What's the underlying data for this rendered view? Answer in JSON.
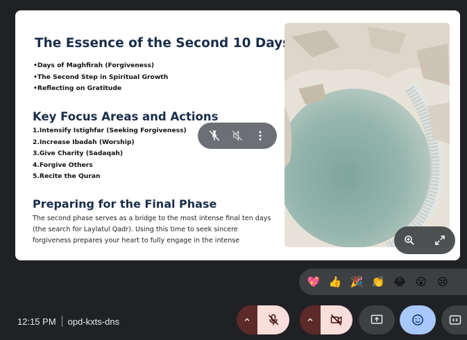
{
  "slide": {
    "heading_essence": "The Essence of the Second 10 Days",
    "bullets": [
      "•Days of Maghfirah (Forgiveness)",
      "•The Second Step in Spiritual Growth",
      "•Reflecting on Gratitude"
    ],
    "heading_key": "Key Focus Areas and Actions",
    "actions": [
      "1.Intensify Istighfar (Seeking Forgiveness)",
      "2.Increase Ibadah (Worship)",
      "3.Give Charity (Sadaqah)",
      "4.Forgive Others",
      "5.Recite the Quran"
    ],
    "heading_prep": "Preparing for the Final Phase",
    "paragraph": "The second phase serves as a bridge to the most intense final ten days (the search for Laylatul Qadr). Using this time to seek sincere forgiveness prepares your heart to fully engage in the intense"
  },
  "float_controls": {
    "icons": [
      "unpin-icon",
      "mute-off-icon",
      "more-vert-icon"
    ]
  },
  "zoom_controls": {
    "icons": [
      "zoom-in-icon",
      "fullscreen-icon"
    ]
  },
  "reactions": [
    "💖",
    "👍",
    "🎉",
    "👏",
    "😂",
    "😮",
    "😢"
  ],
  "meeting": {
    "time": "12:15 PM",
    "code": "opd-kxts-dns"
  },
  "controls": {
    "mic_state": "off",
    "camera_state": "off",
    "red_button_color": "#f9dedc",
    "chevron_color": "#5c2b29",
    "emoji_button_color": "#a8c7fa"
  }
}
